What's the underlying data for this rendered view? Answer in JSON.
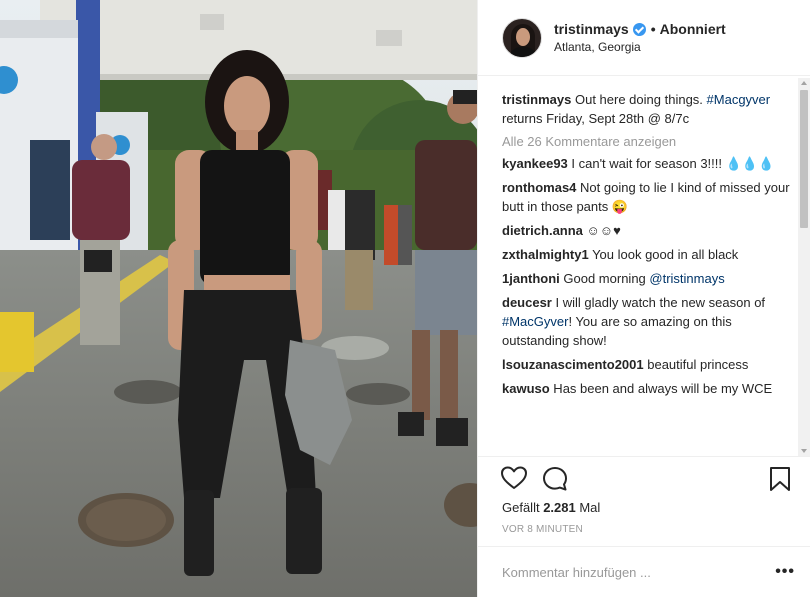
{
  "post": {
    "username": "tristinmays",
    "follow_state": "Abonniert",
    "location": "Atlanta, Georgia",
    "caption_user": "tristinmays",
    "caption_text_1": " Out here doing things. ",
    "caption_tag": "#Macgyver",
    "caption_text_2": " returns Friday, Sept 28th @ 8/7c",
    "view_all": "Alle 26 Kommentare anzeigen",
    "likes_prefix": "Gefällt ",
    "likes_count": "2.281",
    "likes_suffix": " Mal",
    "time": "VOR 8 MINUTEN",
    "comment_placeholder": "Kommentar hinzufügen ...",
    "more_label": "•••"
  },
  "comments": [
    {
      "user": "kyankee93",
      "text": " I can't wait for season 3!!!! 💧💧💧"
    },
    {
      "user": "ronthomas4",
      "text": " Not going to lie I kind of missed your butt in those pants 😜"
    },
    {
      "user": "dietrich.anna",
      "text": " ☺☺♥"
    },
    {
      "user": "zxthalmighty1",
      "text": " You look good in all black"
    },
    {
      "user": "1janthoni",
      "text": " Good morning ",
      "tag": "@tristinmays"
    },
    {
      "user": "deucesr",
      "text": " I will gladly watch the new season of ",
      "tag": "#MacGyver",
      "text2": "! You are so amazing on this outstanding show!"
    },
    {
      "user": "lsouzanascimento2001",
      "text": " beautiful princess"
    },
    {
      "user": "kawuso",
      "text": " Has been and always will be my WCE"
    }
  ],
  "icons": {
    "like": "heart-icon",
    "comment": "comment-icon",
    "save": "bookmark-icon",
    "verified": "verified-badge-icon",
    "more": "more-options-icon"
  },
  "colors": {
    "link": "#003569",
    "verified": "#3897f0",
    "muted": "#999999",
    "text": "#262626"
  }
}
